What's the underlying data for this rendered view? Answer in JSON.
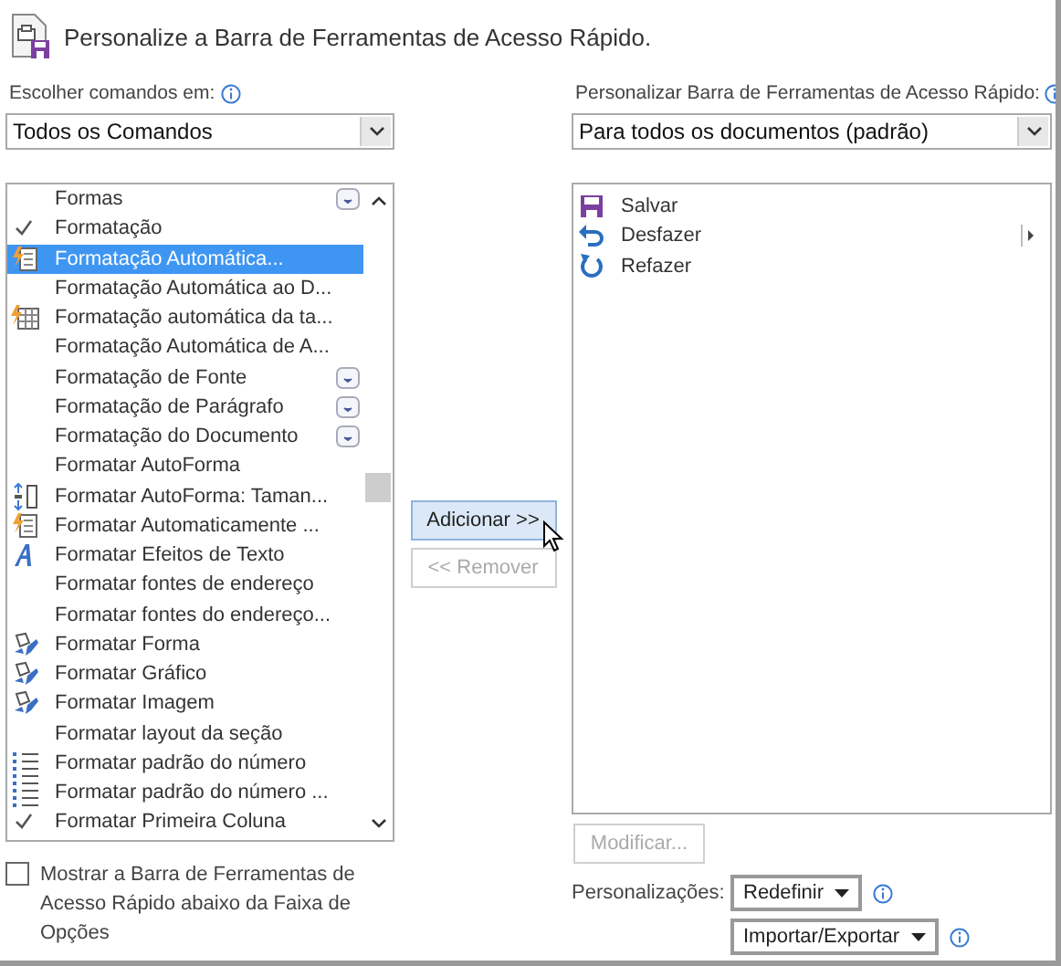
{
  "window": {
    "title": "Personalize a Barra de Ferramentas de Acesso Rápido."
  },
  "left": {
    "label": "Escolher comandos em:",
    "combo": "Todos os Comandos",
    "items": [
      {
        "label": "Formas",
        "kind": "none",
        "dropdown": true,
        "selected": false
      },
      {
        "label": "Formatação",
        "kind": "check",
        "dropdown": false,
        "selected": false
      },
      {
        "label": "Formatação Automática...",
        "kind": "lightning-doc",
        "dropdown": false,
        "selected": true
      },
      {
        "label": "Formatação Automática ao D...",
        "kind": "none",
        "dropdown": false,
        "selected": false
      },
      {
        "label": "Formatação automática da ta...",
        "kind": "lightning-table",
        "dropdown": false,
        "selected": false
      },
      {
        "label": "Formatação Automática de A...",
        "kind": "none",
        "dropdown": false,
        "selected": false
      },
      {
        "label": "Formatação de Fonte",
        "kind": "none",
        "dropdown": true,
        "selected": false
      },
      {
        "label": "Formatação de Parágrafo",
        "kind": "none",
        "dropdown": true,
        "selected": false
      },
      {
        "label": "Formatação do Documento",
        "kind": "none",
        "dropdown": true,
        "selected": false
      },
      {
        "label": "Formatar AutoForma",
        "kind": "none",
        "dropdown": false,
        "selected": false
      },
      {
        "label": "Formatar AutoForma: Taman...",
        "kind": "resize",
        "dropdown": false,
        "selected": false
      },
      {
        "label": "Formatar Automaticamente ...",
        "kind": "lightning-doc",
        "dropdown": false,
        "selected": false
      },
      {
        "label": "Formatar Efeitos de Texto",
        "kind": "text-effect",
        "dropdown": false,
        "selected": false
      },
      {
        "label": "Formatar fontes de endereço",
        "kind": "none",
        "dropdown": false,
        "selected": false
      },
      {
        "label": "Formatar fontes do endereço...",
        "kind": "none",
        "dropdown": false,
        "selected": false
      },
      {
        "label": "Formatar Forma",
        "kind": "shape-paint",
        "dropdown": false,
        "selected": false
      },
      {
        "label": "Formatar Gráfico",
        "kind": "shape-paint",
        "dropdown": false,
        "selected": false
      },
      {
        "label": "Formatar Imagem",
        "kind": "shape-paint",
        "dropdown": false,
        "selected": false
      },
      {
        "label": "Formatar layout da seção",
        "kind": "none",
        "dropdown": false,
        "selected": false
      },
      {
        "label": "Formatar padrão do número",
        "kind": "numbered-list",
        "dropdown": false,
        "selected": false
      },
      {
        "label": "Formatar padrão do número ...",
        "kind": "numbered-list",
        "dropdown": false,
        "selected": false
      },
      {
        "label": "Formatar Primeira Coluna",
        "kind": "check",
        "dropdown": false,
        "selected": false
      }
    ]
  },
  "move_buttons": [
    {
      "label": "Adicionar >>",
      "disabled": false,
      "hovered": true
    },
    {
      "label": "<< Remover",
      "disabled": true,
      "hovered": false
    }
  ],
  "right": {
    "label": "Personalizar Barra de Ferramentas de Acesso Rápido:",
    "combo": "Para todos os documentos (padrão)",
    "items": [
      {
        "label": "Salvar",
        "kind": "save",
        "submenu": false,
        "selected": false
      },
      {
        "label": "Desfazer",
        "kind": "undo",
        "submenu": true,
        "selected": false
      },
      {
        "label": "Refazer",
        "kind": "redo",
        "submenu": false,
        "selected": false
      }
    ],
    "modify_button": {
      "label": "Modificar...",
      "disabled": true
    },
    "customizations_label": "Personalizações:",
    "reset_button": "Redefinir",
    "import_export_button": "Importar/Exportar"
  },
  "show_below_ribbon": {
    "label": "Mostrar a Barra de Ferramentas de Acesso Rápido abaixo da Faixa de Opções",
    "checked": false
  }
}
